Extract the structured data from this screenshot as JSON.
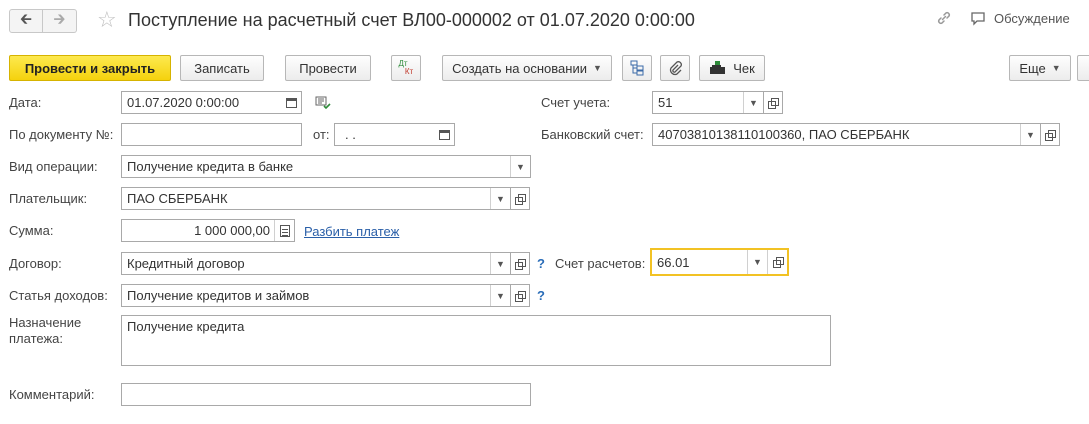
{
  "header": {
    "title": "Поступление на расчетный счет ВЛ00-000002 от 01.07.2020 0:00:00",
    "discussion": "Обсуждение"
  },
  "toolbar": {
    "post_close": "Провести и закрыть",
    "save": "Записать",
    "post": "Провести",
    "dtkt_top": "Дт",
    "dtkt_bottom": "Кт",
    "create_based": "Создать на основании",
    "check": "Чек",
    "more": "Еще"
  },
  "fields": {
    "date": {
      "label": "Дата:",
      "value": "01.07.2020  0:00:00"
    },
    "doc_number": {
      "label": "По документу №:",
      "value": ""
    },
    "from": {
      "label": "от:",
      "value": " .  ."
    },
    "operation": {
      "label": "Вид операции:",
      "value": "Получение кредита в банке"
    },
    "payer": {
      "label": "Плательщик:",
      "value": "ПАО СБЕРБАНК"
    },
    "amount": {
      "label": "Сумма:",
      "value": "1 000 000,00"
    },
    "split_payment": "Разбить платеж",
    "contract": {
      "label": "Договор:",
      "value": "Кредитный договор"
    },
    "income_item": {
      "label": "Статья доходов:",
      "value": "Получение кредитов и займов"
    },
    "purpose": {
      "label_line1": "Назначение",
      "label_line2": "платежа:",
      "value": "Получение кредита"
    },
    "comment": {
      "label": "Комментарий:",
      "value": ""
    },
    "account": {
      "label": "Счет учета:",
      "value": "51"
    },
    "bank_account": {
      "label": "Банковский счет:",
      "value": "40703810138110100360, ПАО СБЕРБАНК"
    },
    "settlement_account": {
      "label": "Счет расчетов:",
      "value": "66.01"
    },
    "help_mark": "?"
  },
  "colors": {
    "accent": "#f5d20d",
    "focus": "#f2c224",
    "link": "#2a5fa8"
  }
}
